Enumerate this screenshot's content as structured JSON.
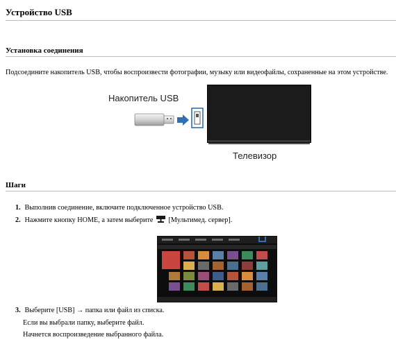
{
  "page": {
    "title": "Устройство USB"
  },
  "section1": {
    "heading": "Установка соединения",
    "text": "Подсоедините накопитель USB, чтобы воспроизвести фотографии, музыку или видеофайлы, сохраненные на этом устройстве."
  },
  "illustration": {
    "usb_label": "Накопитель USB",
    "tv_label": "Телевизор"
  },
  "section2": {
    "heading": "Шаги",
    "steps": [
      {
        "num": "1.",
        "text": "Выполнив соединение, включите подключенное устройство USB."
      },
      {
        "num": "2.",
        "text_before": "Нажмите кнопку HOME, а затем выберите",
        "text_after": "[Мультимед. сервер]."
      },
      {
        "num": "3.",
        "text": "Выберите [USB] → папка или файл из списка.",
        "sub1": "Если вы выбрали папку, выберите файл.",
        "sub2": "Начнется воспроизведение выбранного файла."
      }
    ]
  },
  "colors": {
    "accent_blue": "#2f6fb2",
    "rule": "#bdbdbd"
  },
  "icons": [
    "media-server-icon",
    "usb-stick-icon",
    "arrow-right-icon",
    "usb-port-icon"
  ]
}
